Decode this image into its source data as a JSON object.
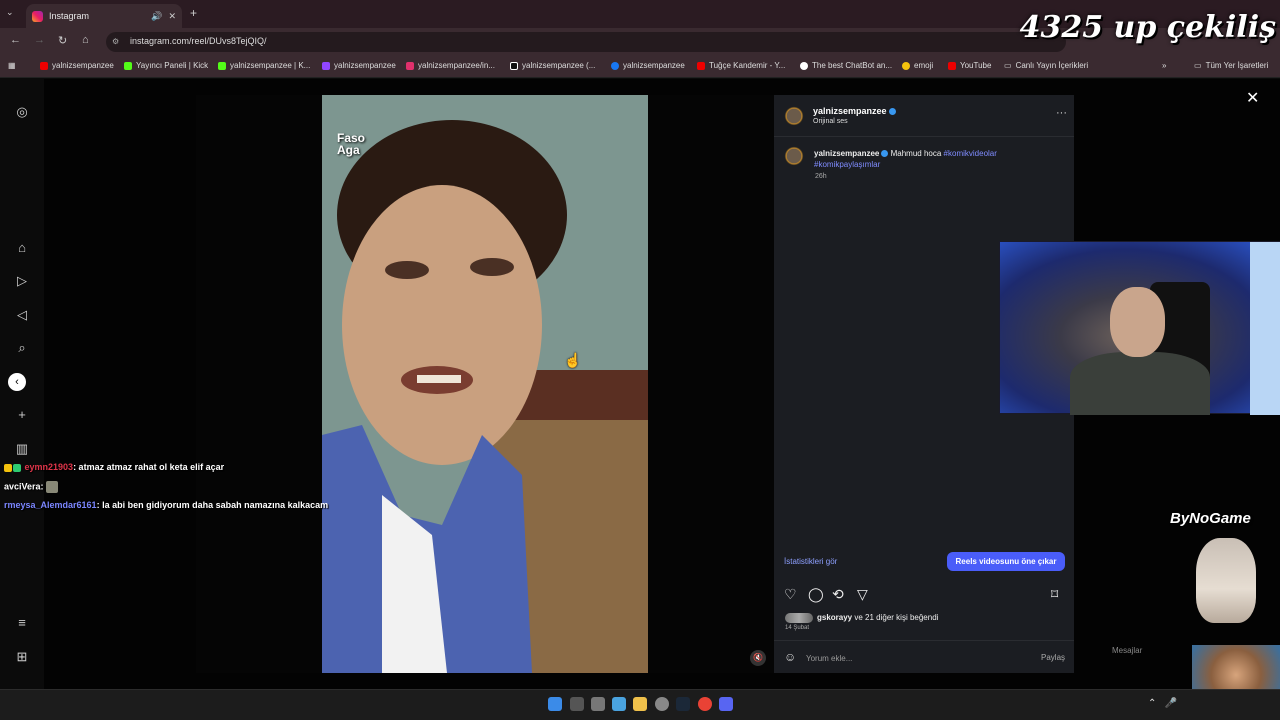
{
  "browser": {
    "tab_title": "Instagram",
    "url": "instagram.com/reel/DUvs8TejQIQ/",
    "bookmarks": [
      "yalnizsempanzee",
      "Yayıncı Paneli | Kick",
      "yalnizsempanzee | K...",
      "yalnizsempanzee",
      "yalnizsempanzee/in...",
      "yalnizsempanzee (...",
      "yalnizsempanzee",
      "Tuğçe Kandemir - Y...",
      "The best ChatBot an...",
      "emoji",
      "YouTube",
      "Canlı Yayın İçerikleri"
    ],
    "all_bookmarks": "Tüm Yer İşaretleri"
  },
  "overlay": {
    "title": "4325 up çekiliş",
    "brand": "ByNoGame",
    "messages": "Mesajlar"
  },
  "video": {
    "label_line1": "Faso",
    "label_line2": "Aga"
  },
  "post": {
    "username": "yalnizsempanzee",
    "audio": "Orijinal ses",
    "caption_text": "Mahmud hoca",
    "tag1": "#komikvideolar",
    "tag2": "#komikpaylaşımlar",
    "time": "26h",
    "stats_link": "İstatistikleri gör",
    "boost_button": "Reels videosunu öne çıkar",
    "likes_user": "gskorayy",
    "likes_rest": "ve 21 diğer kişi beğendi",
    "date": "14 Şubat",
    "comment_placeholder": "Yorum ekle...",
    "share": "Paylaş"
  },
  "chat": [
    {
      "name": "eymn21903",
      "message": ": atmaz atmaz rahat ol keta elif açar"
    },
    {
      "name": "avciVera",
      "message": ":"
    },
    {
      "name": "rmeysa_Alemdar6161",
      "message": ": la abi ben gidiyorum daha sabah namazına kalkacam"
    }
  ]
}
